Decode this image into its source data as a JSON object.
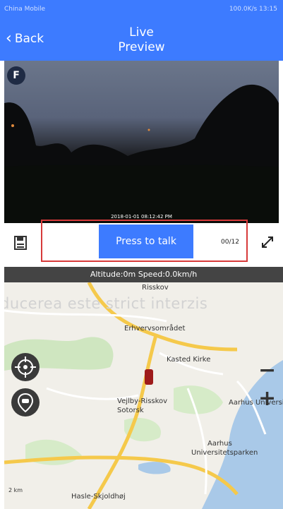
{
  "status": {
    "carrier": "China Mobile",
    "right": "100.0K/s 13:15"
  },
  "header": {
    "back_label": "Back",
    "title_line1": "Live",
    "title_line2": "Preview"
  },
  "video": {
    "badge": "F",
    "timestamp": "2018-01-01 08:12:42 PM"
  },
  "controls": {
    "talk_label": "Press to talk",
    "counter": "00/12"
  },
  "info": {
    "text": "Altitude:0m    Speed:0.0km/h"
  },
  "map": {
    "watermark": "ducerea este strict interzis",
    "labels": {
      "top": "Risskov",
      "erhvervsomrade": "Erhvervsområdet",
      "kasted_kirke": "Kasted Kirke",
      "vejlby": "Vejlby-Risskov",
      "vejlby2": "Sotorsk",
      "aarhus_uni": "Aarhus Universitet",
      "aarhus": "Aarhus",
      "aarhus2": "Universitetsparken",
      "bottom": "Hasle-Skjoldhøj"
    },
    "scale": "2 km",
    "plus": "+",
    "minus": "−"
  },
  "colors": {
    "accent": "#3d7bff",
    "highlight": "#d73a3a",
    "car": "#9e1b1b"
  }
}
